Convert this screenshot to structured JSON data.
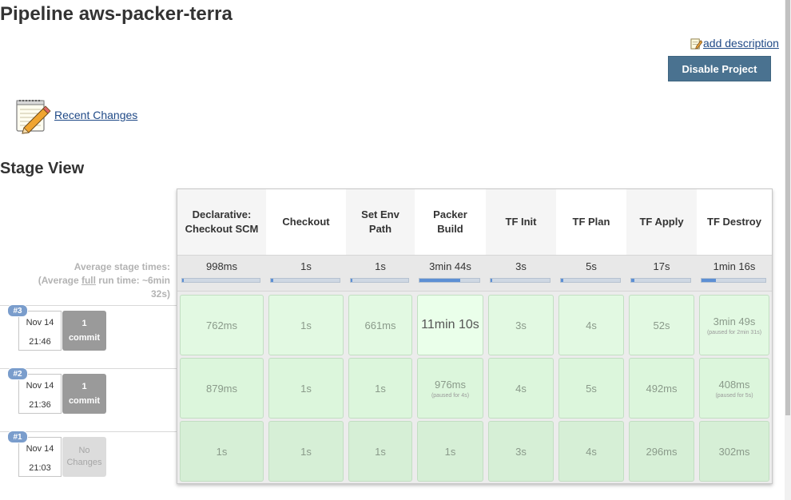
{
  "page": {
    "title": "Pipeline aws-packer-terra",
    "add_description": "add description",
    "disable_button": "Disable Project",
    "recent_changes": "Recent Changes",
    "stage_view_title": "Stage View"
  },
  "stage_view": {
    "avg_label_line1": "Average stage times:",
    "avg_label_prefix": "(Average ",
    "avg_label_full": "full",
    "avg_label_suffix": " run time: ~6min",
    "avg_label_line3": "32s)",
    "stages": [
      {
        "name": "Declarative: Checkout SCM",
        "avg": "998ms",
        "avg_fraction": 0.02
      },
      {
        "name": "Checkout",
        "avg": "1s",
        "avg_fraction": 0.03
      },
      {
        "name": "Set Env Path",
        "avg": "1s",
        "avg_fraction": 0.03
      },
      {
        "name": "Packer Build",
        "avg": "3min 44s",
        "avg_fraction": 0.68
      },
      {
        "name": "TF Init",
        "avg": "3s",
        "avg_fraction": 0.03
      },
      {
        "name": "TF Plan",
        "avg": "5s",
        "avg_fraction": 0.04
      },
      {
        "name": "TF Apply",
        "avg": "17s",
        "avg_fraction": 0.06
      },
      {
        "name": "TF Destroy",
        "avg": "1min 16s",
        "avg_fraction": 0.22
      }
    ],
    "runs": [
      {
        "id": "#3",
        "date": "Nov 14",
        "time": "21:46",
        "commits_line1": "1",
        "commits_line2": "commit",
        "cells": [
          {
            "value": "762ms"
          },
          {
            "value": "1s"
          },
          {
            "value": "661ms"
          },
          {
            "value": "11min 10s"
          },
          {
            "value": "3s"
          },
          {
            "value": "4s"
          },
          {
            "value": "52s"
          },
          {
            "value": "3min 49s",
            "paused": "(paused for 2min 31s)"
          }
        ]
      },
      {
        "id": "#2",
        "date": "Nov 14",
        "time": "21:36",
        "commits_line1": "1",
        "commits_line2": "commit",
        "cells": [
          {
            "value": "879ms"
          },
          {
            "value": "1s"
          },
          {
            "value": "1s"
          },
          {
            "value": "976ms",
            "paused": "(paused for 4s)"
          },
          {
            "value": "4s"
          },
          {
            "value": "5s"
          },
          {
            "value": "492ms"
          },
          {
            "value": "408ms",
            "paused": "(paused for 5s)"
          }
        ]
      },
      {
        "id": "#1",
        "date": "Nov 14",
        "time": "21:03",
        "commits_line1": "No",
        "commits_line2": "Changes",
        "cells": [
          {
            "value": "1s"
          },
          {
            "value": "1s"
          },
          {
            "value": "1s"
          },
          {
            "value": "1s"
          },
          {
            "value": "3s"
          },
          {
            "value": "4s"
          },
          {
            "value": "296ms"
          },
          {
            "value": "302ms"
          }
        ]
      }
    ]
  },
  "icons": {
    "add_description": "pencil-notepad-icon",
    "recent_changes": "notepad-icon"
  }
}
